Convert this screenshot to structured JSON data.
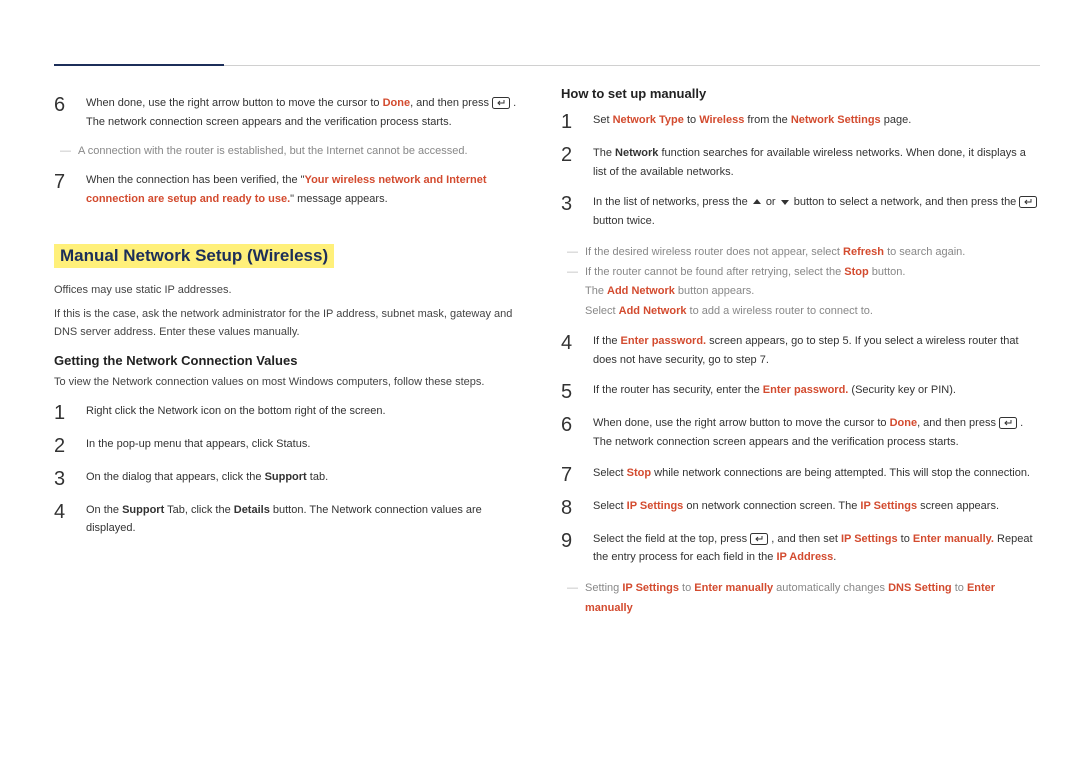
{
  "left": {
    "step6": {
      "pre": "When done, use the right arrow button to move the cursor to ",
      "done": "Done",
      "mid": ", and then press ",
      "post": ". The network connection screen appears and the verification process starts."
    },
    "note6": "A connection with the router is established, but the Internet cannot be accessed.",
    "step7": {
      "pre": "When the connection has been verified, the \"",
      "msg": "Your wireless network and Internet connection are setup and ready to use.",
      "post": "\" message appears."
    },
    "section_title": "Manual Network Setup (Wireless)",
    "intro1": "Offices may use static IP addresses.",
    "intro2": "If this is the case, ask the network administrator for the IP address, subnet mask, gateway and DNS server address. Enter these values manually.",
    "sub_getting": "Getting the Network Connection Values",
    "getting_intro": "To view the Network connection values on most Windows computers, follow these steps.",
    "g1": "Right click the Network icon on the bottom right of the screen.",
    "g2": "In the pop-up menu that appears, click Status.",
    "g3": {
      "pre": "On the dialog that appears, click the ",
      "b": "Support",
      "post": " tab."
    },
    "g4": {
      "pre": "On the ",
      "b1": "Support",
      "mid": " Tab, click the ",
      "b2": "Details",
      "post": " button. The Network connection values are displayed."
    }
  },
  "right": {
    "subheading": "How to set up manually",
    "s1": {
      "pre": "Set ",
      "a": "Network Type",
      "mid": " to ",
      "b": "Wireless",
      "mid2": " from the ",
      "c": "Network Settings",
      "post": " page."
    },
    "s2": {
      "pre": "The ",
      "b": "Network",
      "post": " function searches for available wireless networks. When done, it displays a list of the available networks."
    },
    "s3": {
      "pre": "In the list of networks, press the ",
      "mid": " or ",
      "mid2": " button to select a network, and then press the ",
      "post": " button twice."
    },
    "s3_notes": {
      "n1_pre": "If the desired wireless router does not appear, select ",
      "n1_b": "Refresh",
      "n1_post": " to search again.",
      "n2_pre": "If the router cannot be found after retrying, select the ",
      "n2_b": "Stop",
      "n2_post": " button.",
      "n3_pre": "The ",
      "n3_b": "Add Network",
      "n3_post": " button appears.",
      "n4_pre": "Select ",
      "n4_b": "Add Network",
      "n4_post": " to add a wireless router to connect to."
    },
    "s4": {
      "pre": "If the ",
      "b": "Enter password.",
      "post": " screen appears, go to step 5. If you select a wireless router that does not have security, go to step 7."
    },
    "s5": {
      "pre": "If the router has security, enter the ",
      "b": "Enter password.",
      "post": " (Security key or PIN)."
    },
    "s6": {
      "pre": "When done, use the right arrow button to move the cursor to ",
      "b": "Done",
      "mid": ", and then press ",
      "post": ". The network connection screen appears and the verification process starts."
    },
    "s7": {
      "pre": "Select ",
      "b": "Stop",
      "post": " while network connections are being attempted. This will stop the connection."
    },
    "s8": {
      "pre": "Select ",
      "b1": "IP Settings",
      "mid": " on network connection screen. The ",
      "b2": "IP Settings",
      "post": " screen appears."
    },
    "s9": {
      "pre": "Select the field at the top, press ",
      "mid": ", and then set ",
      "b1": "IP Settings",
      "mid2": " to ",
      "b2": "Enter manually.",
      "mid3": " Repeat the entry process for each field in the ",
      "b3": "IP Address",
      "post": "."
    },
    "s9_note": {
      "pre": "Setting ",
      "b1": "IP Settings",
      "mid": " to ",
      "b2": "Enter manually",
      "mid2": " automatically changes ",
      "b3": "DNS Setting",
      "mid3": " to ",
      "b4": "Enter manually"
    }
  },
  "nums": {
    "n1": "1",
    "n2": "2",
    "n3": "3",
    "n4": "4",
    "n5": "5",
    "n6": "6",
    "n7": "7",
    "n8": "8",
    "n9": "9"
  }
}
